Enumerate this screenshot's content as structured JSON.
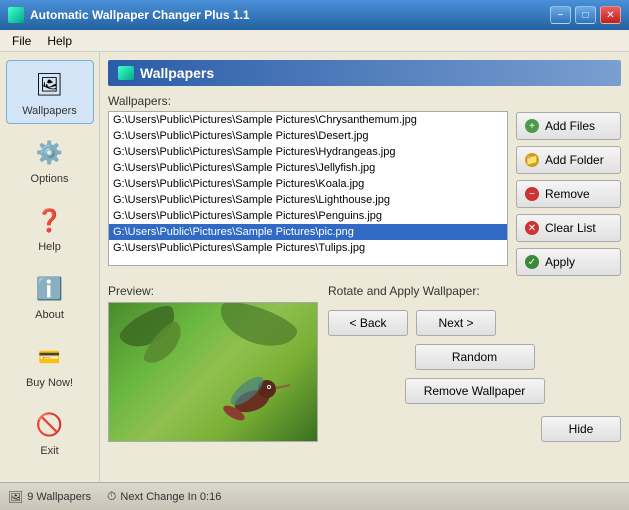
{
  "titleBar": {
    "icon": "wallpaper-icon",
    "title": "Automatic Wallpaper Changer Plus 1.1",
    "minimizeLabel": "−",
    "maximizeLabel": "□",
    "closeLabel": "✕"
  },
  "menuBar": {
    "items": [
      {
        "label": "File",
        "id": "file-menu"
      },
      {
        "label": "Help",
        "id": "help-menu"
      }
    ]
  },
  "sidebar": {
    "items": [
      {
        "id": "wallpapers",
        "label": "Wallpapers",
        "icon": "🖼",
        "active": true
      },
      {
        "id": "options",
        "label": "Options",
        "icon": "⚙"
      },
      {
        "id": "help",
        "label": "Help",
        "icon": "❓"
      },
      {
        "id": "about",
        "label": "About",
        "icon": "ℹ"
      },
      {
        "id": "buynow",
        "label": "Buy Now!",
        "icon": "💳"
      },
      {
        "id": "exit",
        "label": "Exit",
        "icon": "🚫"
      }
    ]
  },
  "wallpapersSection": {
    "title": "Wallpapers",
    "listLabel": "Wallpapers:",
    "items": [
      "G:\\Users\\Public\\Pictures\\Sample Pictures\\Chrysanthemum.jpg",
      "G:\\Users\\Public\\Pictures\\Sample Pictures\\Desert.jpg",
      "G:\\Users\\Public\\Pictures\\Sample Pictures\\Hydrangeas.jpg",
      "G:\\Users\\Public\\Pictures\\Sample Pictures\\Jellyfish.jpg",
      "G:\\Users\\Public\\Pictures\\Sample Pictures\\Koala.jpg",
      "G:\\Users\\Public\\Pictures\\Sample Pictures\\Lighthouse.jpg",
      "G:\\Users\\Public\\Pictures\\Sample Pictures\\Penguins.jpg",
      "G:\\Users\\Public\\Pictures\\Sample Pictures\\pic.png",
      "G:\\Users\\Public\\Pictures\\Sample Pictures\\Tulips.jpg"
    ],
    "selectedIndex": 7,
    "buttons": {
      "addFiles": "Add Files",
      "addFolder": "Add Folder",
      "remove": "Remove",
      "clearList": "Clear List",
      "apply": "Apply"
    }
  },
  "previewSection": {
    "label": "Preview:"
  },
  "rotateSection": {
    "title": "Rotate and Apply Wallpaper:",
    "backLabel": "< Back",
    "nextLabel": "Next >",
    "randomLabel": "Random",
    "removeWallpaperLabel": "Remove Wallpaper",
    "hideLabel": "Hide"
  },
  "statusBar": {
    "wallpaperCount": "9 Wallpapers",
    "nextChange": "Next Change In 0:16"
  }
}
